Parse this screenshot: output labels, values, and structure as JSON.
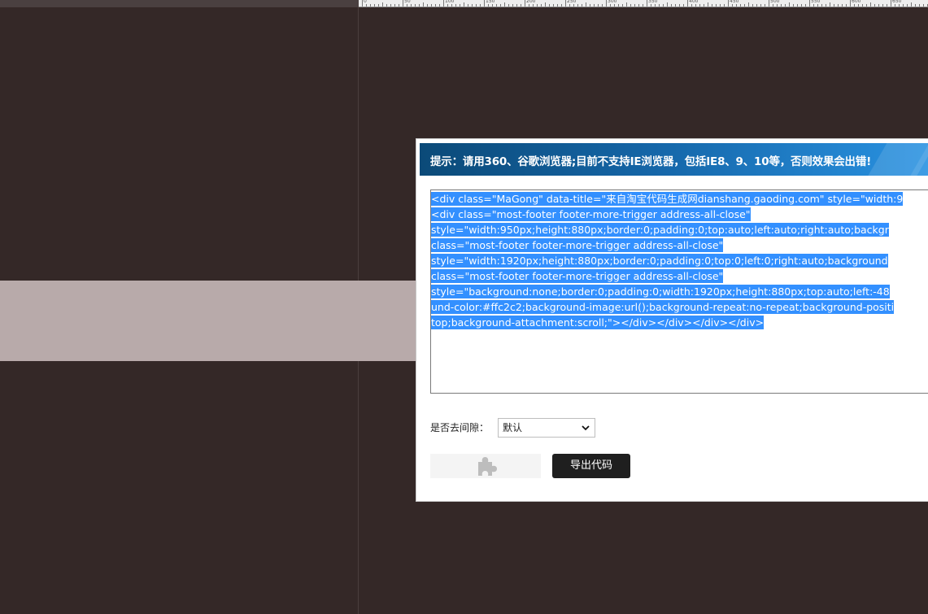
{
  "dialog": {
    "title": "提示：请用360、谷歌浏览器;目前不支持IE浏览器，包括IE8、9、10等，否则效果会出错!",
    "code_lines": [
      "<div class=\"MaGong\" data-title=\"来自淘宝代码生成网dianshang.gaoding.com\" style=\"width:9",
      "<div class=\"most-footer footer-more-trigger address-all-close\" ",
      "style=\"width:950px;height:880px;border:0;padding:0;top:auto;left:auto;right:auto;backgr",
      "class=\"most-footer footer-more-trigger address-all-close\" ",
      "style=\"width:1920px;height:880px;border:0;padding:0;top:0;left:0;right:auto;background",
      "class=\"most-footer footer-more-trigger address-all-close\" ",
      "style=\"background:none;border:0;padding:0;width:1920px;height:880px;top:auto;left:-48",
      "und-color:#ffc2c2;background-image:url();background-repeat:no-repeat;background-positi",
      "top;background-attachment:scroll;\"></div></div></div></div>"
    ],
    "gap_label": "是否去间隙：",
    "gap_select_value": "默认",
    "export_label": "导出代码",
    "puzzle_icon": "puzzle-piece-icon"
  },
  "ruler": {
    "labels": [
      "0",
      "50",
      "100",
      "150",
      "200",
      "250",
      "300",
      "350",
      "400",
      "450",
      "500",
      "550",
      "600",
      "650"
    ]
  },
  "colors": {
    "canvas_bg": "#342827",
    "band": "#b8aaaa",
    "header_start": "#0b4a78",
    "header_end": "#2a94e4",
    "selection": "#3390ff",
    "export_button": "#1f1f1f"
  }
}
